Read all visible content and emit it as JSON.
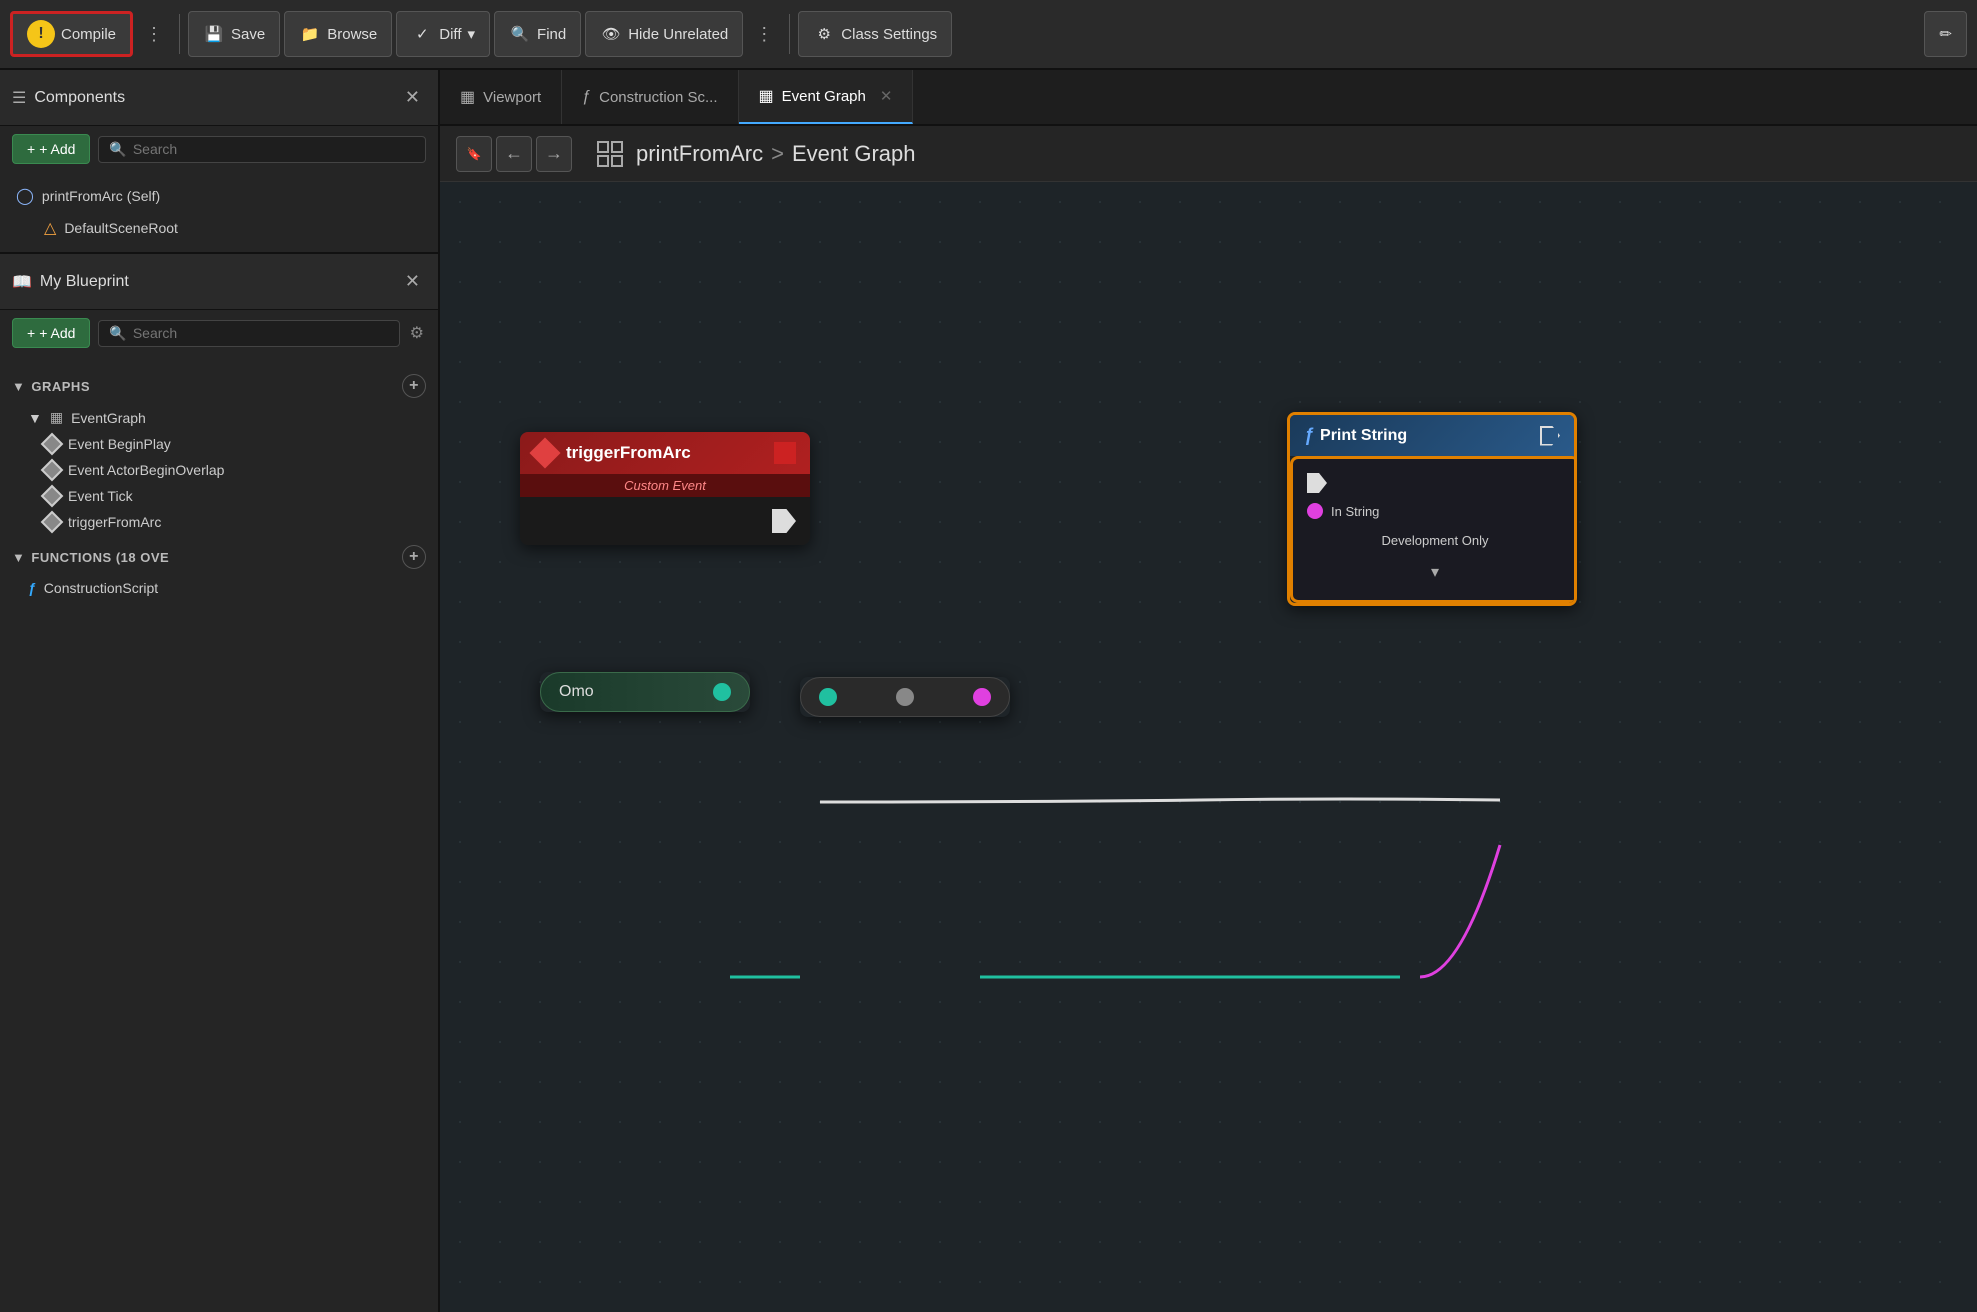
{
  "toolbar": {
    "compile_label": "Compile",
    "save_label": "Save",
    "browse_label": "Browse",
    "diff_label": "Diff",
    "find_label": "Find",
    "hide_unrelated_label": "Hide Unrelated",
    "class_settings_label": "Class Settings",
    "dots_label": "⋮"
  },
  "components_panel": {
    "title": "Components",
    "search_placeholder": "Search",
    "add_label": "+ Add",
    "items": [
      {
        "label": "printFromArc (Self)",
        "type": "person",
        "icon": "👤"
      },
      {
        "label": "DefaultSceneRoot",
        "type": "scene",
        "icon": "△"
      }
    ]
  },
  "blueprint_panel": {
    "title": "My Blueprint",
    "search_placeholder": "Search",
    "add_label": "+ Add",
    "sections": {
      "graphs": {
        "label": "GRAPHS",
        "items": [
          {
            "label": "EventGraph",
            "type": "graph",
            "children": [
              {
                "label": "Event BeginPlay"
              },
              {
                "label": "Event ActorBeginOverlap"
              },
              {
                "label": "Event Tick"
              },
              {
                "label": "triggerFromArc"
              }
            ]
          }
        ]
      },
      "functions": {
        "label": "FUNCTIONS",
        "count": "18 OVE",
        "items": [
          {
            "label": "ConstructionScript"
          }
        ]
      }
    }
  },
  "tabs": [
    {
      "label": "Viewport",
      "icon": "▦",
      "active": false
    },
    {
      "label": "Construction Sc...",
      "icon": "ƒ",
      "active": false
    },
    {
      "label": "Event Graph",
      "icon": "▦",
      "active": true
    }
  ],
  "breadcrumb": {
    "back_label": "←",
    "forward_label": "→",
    "path_root": "printFromArc",
    "path_separator": ">",
    "path_leaf": "Event Graph"
  },
  "nodes": {
    "trigger": {
      "title": "triggerFromArc",
      "subtitle": "Custom Event"
    },
    "print_string": {
      "title": "Print String",
      "pin_in_label": "In String",
      "dev_only_label": "Development Only"
    },
    "omo": {
      "label": "Omo"
    }
  }
}
